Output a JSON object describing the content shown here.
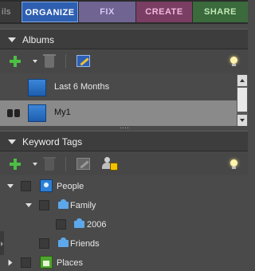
{
  "tabs": {
    "edge_label": "ils",
    "organize": "ORGANIZE",
    "fix": "FIX",
    "create": "CREATE",
    "share": "SHARE"
  },
  "albums": {
    "title": "Albums",
    "items": [
      {
        "label": "Last 6 Months",
        "selected": false
      },
      {
        "label": "My1",
        "selected": true
      }
    ]
  },
  "keyword_tags": {
    "title": "Keyword Tags",
    "tree": {
      "people": "People",
      "family": "Family",
      "year_2006": "2006",
      "friends": "Friends",
      "places": "Places"
    }
  },
  "icons": {
    "new": "plus-icon",
    "menu": "dropdown-arrow-icon",
    "delete": "trash-icon",
    "edit": "edit-icon",
    "tips": "lightbulb-icon",
    "people_recognition": "people-recognition-icon"
  },
  "colors": {
    "organize_tab": "#2f5fb0",
    "fix_tab": "#6f6492",
    "create_tab": "#7a3d63",
    "share_tab": "#3b6a3c",
    "add_green": "#4cc043",
    "album_blue": "#2d7fd6",
    "selection_gray": "#8a8a8a"
  }
}
